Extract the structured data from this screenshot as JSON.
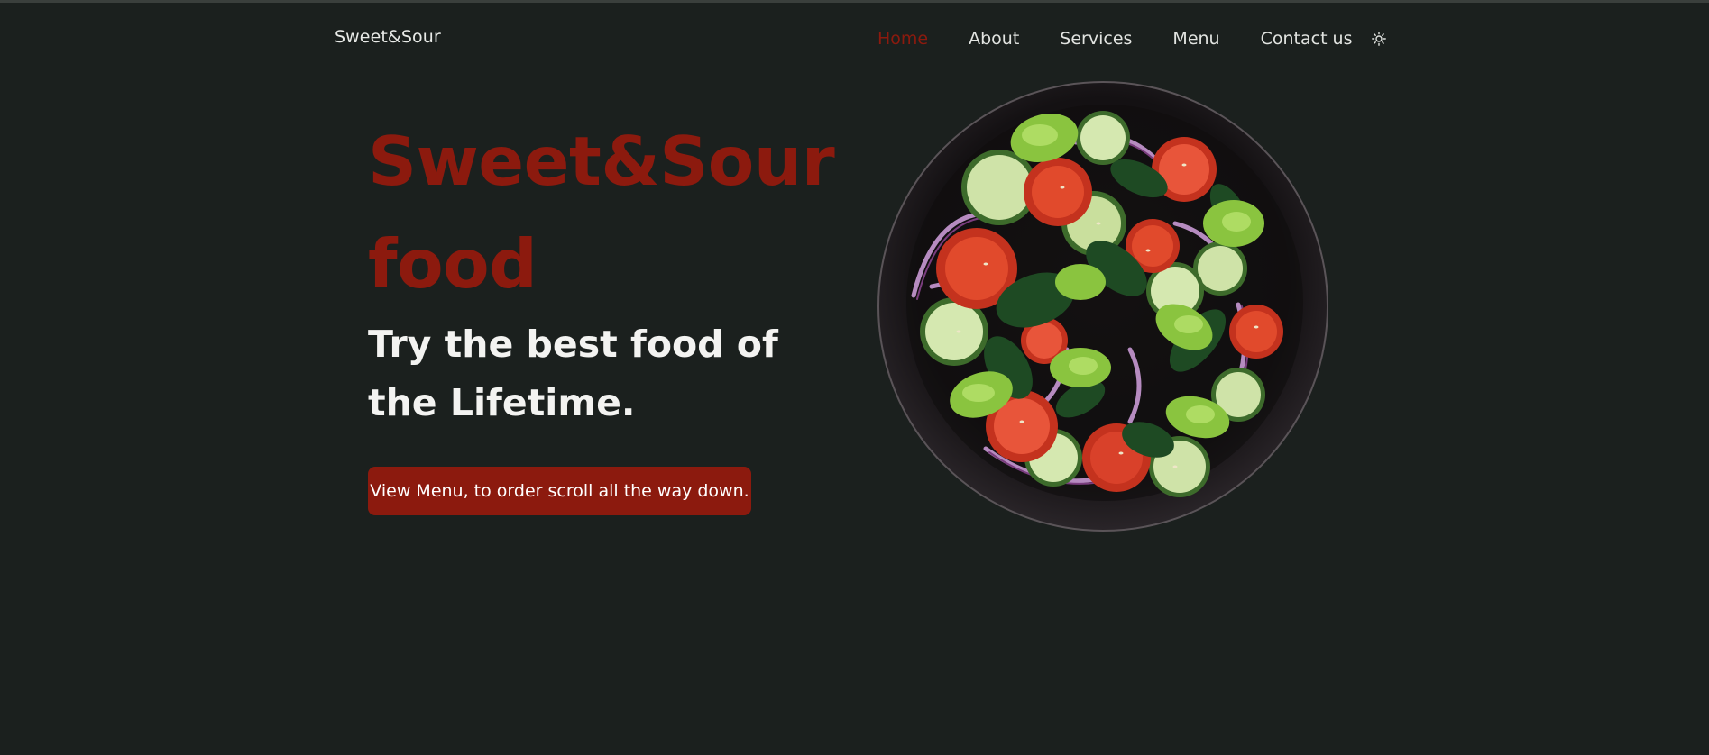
{
  "header": {
    "brand": "Sweet&Sour",
    "nav": [
      {
        "label": "Home",
        "active": true
      },
      {
        "label": "About",
        "active": false
      },
      {
        "label": "Services",
        "active": false
      },
      {
        "label": "Menu",
        "active": false
      },
      {
        "label": "Contact us",
        "active": false
      }
    ],
    "theme_toggle_icon": "sun-icon"
  },
  "hero": {
    "title_line1": "Sweet&Sour",
    "title_line2": "food",
    "subtitle_line1": "Try the best food of",
    "subtitle_line2": "the Lifetime.",
    "cta_label": "View Menu, to order scroll all the way down.",
    "image_alt": "salad-bowl-image"
  },
  "colors": {
    "background": "#1b201e",
    "accent": "#8c1a0e",
    "text": "#f3f3f1"
  }
}
